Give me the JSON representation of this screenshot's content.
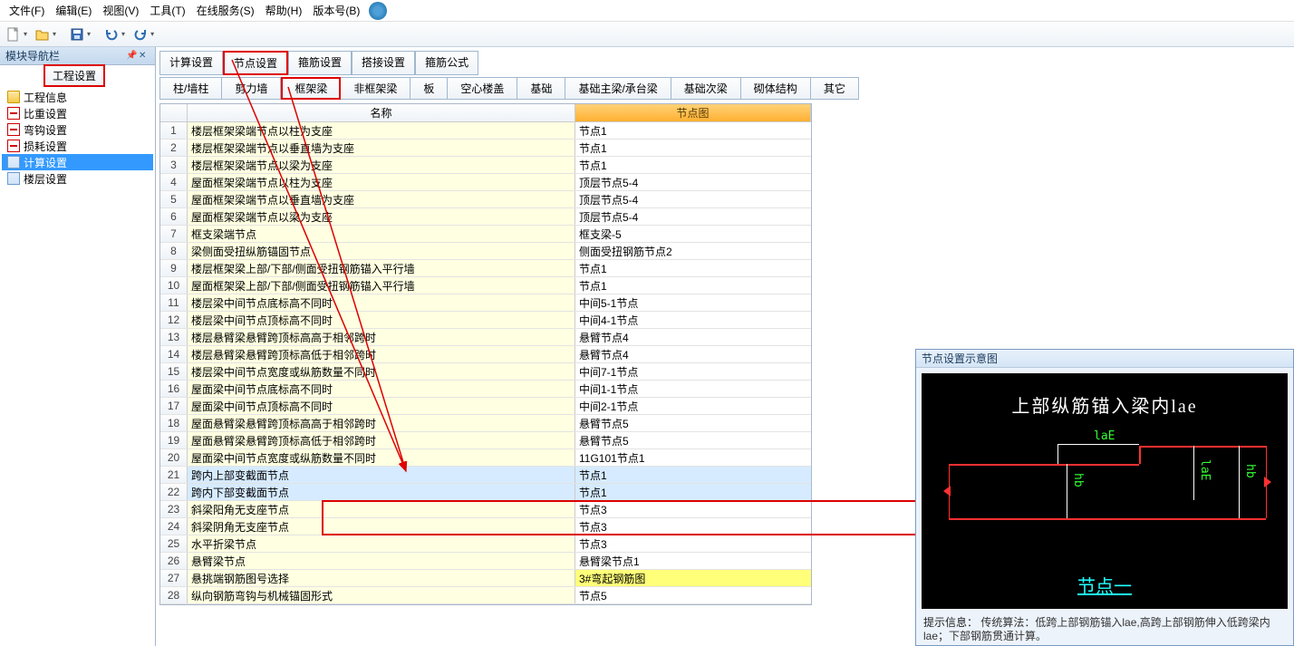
{
  "menu": {
    "file": "文件(F)",
    "edit": "编辑(E)",
    "view": "视图(V)",
    "tools": "工具(T)",
    "online": "在线服务(S)",
    "help": "帮助(H)",
    "version": "版本号(B)"
  },
  "sidebar": {
    "title": "模块导航栏",
    "tab": "工程设置",
    "items": [
      {
        "label": "工程信息"
      },
      {
        "label": "比重设置"
      },
      {
        "label": "弯钩设置"
      },
      {
        "label": "损耗设置"
      },
      {
        "label": "计算设置"
      },
      {
        "label": "楼层设置"
      }
    ]
  },
  "tabs1": [
    {
      "label": "计算设置"
    },
    {
      "label": "节点设置",
      "boxed": true
    },
    {
      "label": "箍筋设置"
    },
    {
      "label": "搭接设置"
    },
    {
      "label": "箍筋公式"
    }
  ],
  "tabs2": [
    {
      "label": "柱/墙柱"
    },
    {
      "label": "剪力墙"
    },
    {
      "label": "框架梁",
      "boxed": true
    },
    {
      "label": "非框架梁"
    },
    {
      "label": "板"
    },
    {
      "label": "空心楼盖"
    },
    {
      "label": "基础"
    },
    {
      "label": "基础主梁/承台梁"
    },
    {
      "label": "基础次梁"
    },
    {
      "label": "砌体结构"
    },
    {
      "label": "其它"
    }
  ],
  "grid": {
    "h_name": "名称",
    "h_img": "节点图",
    "rows": [
      {
        "n": "1",
        "name": "楼层框架梁端节点以柱为支座",
        "val": "节点1"
      },
      {
        "n": "2",
        "name": "楼层框架梁端节点以垂直墙为支座",
        "val": "节点1"
      },
      {
        "n": "3",
        "name": "楼层框架梁端节点以梁为支座",
        "val": "节点1"
      },
      {
        "n": "4",
        "name": "屋面框架梁端节点以柱为支座",
        "val": "顶层节点5-4"
      },
      {
        "n": "5",
        "name": "屋面框架梁端节点以垂直墙为支座",
        "val": "顶层节点5-4"
      },
      {
        "n": "6",
        "name": "屋面框架梁端节点以梁为支座",
        "val": "顶层节点5-4"
      },
      {
        "n": "7",
        "name": "框支梁端节点",
        "val": "框支梁-5"
      },
      {
        "n": "8",
        "name": "梁侧面受扭纵筋锚固节点",
        "val": "侧面受扭钢筋节点2"
      },
      {
        "n": "9",
        "name": "楼层框架梁上部/下部/侧面受扭钢筋锚入平行墙",
        "val": "节点1"
      },
      {
        "n": "10",
        "name": "屋面框架梁上部/下部/侧面受扭钢筋锚入平行墙",
        "val": "节点1"
      },
      {
        "n": "11",
        "name": "楼层梁中间节点底标高不同时",
        "val": "中间5-1节点"
      },
      {
        "n": "12",
        "name": "楼层梁中间节点顶标高不同时",
        "val": "中间4-1节点"
      },
      {
        "n": "13",
        "name": "楼层悬臂梁悬臂跨顶标高高于相邻跨时",
        "val": "悬臂节点4"
      },
      {
        "n": "14",
        "name": "楼层悬臂梁悬臂跨顶标高低于相邻跨时",
        "val": "悬臂节点4"
      },
      {
        "n": "15",
        "name": "楼层梁中间节点宽度或纵筋数量不同时",
        "val": "中间7-1节点"
      },
      {
        "n": "16",
        "name": "屋面梁中间节点底标高不同时",
        "val": "中间1-1节点"
      },
      {
        "n": "17",
        "name": "屋面梁中间节点顶标高不同时",
        "val": "中间2-1节点"
      },
      {
        "n": "18",
        "name": "屋面悬臂梁悬臂跨顶标高高于相邻跨时",
        "val": "悬臂节点5"
      },
      {
        "n": "19",
        "name": "屋面悬臂梁悬臂跨顶标高低于相邻跨时",
        "val": "悬臂节点5"
      },
      {
        "n": "20",
        "name": "屋面梁中间节点宽度或纵筋数量不同时",
        "val": "11G101节点1"
      },
      {
        "n": "21",
        "name": "跨内上部变截面节点",
        "val": "节点1",
        "sel": true
      },
      {
        "n": "22",
        "name": "跨内下部变截面节点",
        "val": "节点1",
        "sel": true
      },
      {
        "n": "23",
        "name": "斜梁阳角无支座节点",
        "val": "节点3"
      },
      {
        "n": "24",
        "name": "斜梁阴角无支座节点",
        "val": "节点3"
      },
      {
        "n": "25",
        "name": "水平折梁节点",
        "val": "节点3"
      },
      {
        "n": "26",
        "name": "悬臂梁节点",
        "val": "悬臂梁节点1"
      },
      {
        "n": "27",
        "name": "悬挑端钢筋图号选择",
        "val": "3#弯起钢筋图",
        "yellow": true
      },
      {
        "n": "28",
        "name": "纵向钢筋弯钩与机械锚固形式",
        "val": "节点5"
      }
    ]
  },
  "preview": {
    "title": "节点设置示意图",
    "cad_title": "上部纵筋锚入梁内lae",
    "dim1": "laE",
    "dim2": "hb",
    "dim3": "laE",
    "dim4": "hb",
    "node_label": "节点一",
    "footer_label": "提示信息：",
    "footer_text": "传统算法：低跨上部钢筋锚入lae,高跨上部钢筋伸入低跨梁内lae；下部钢筋贯通计算。"
  }
}
